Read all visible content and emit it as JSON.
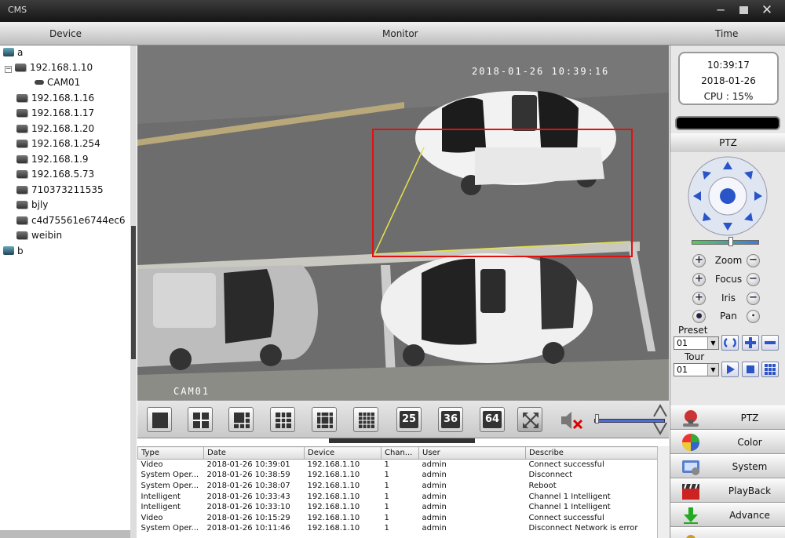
{
  "window": {
    "title": "CMS"
  },
  "header": {
    "device": "Device",
    "monitor": "Monitor",
    "time": "Time"
  },
  "tree": {
    "group_a": "a",
    "devices": [
      {
        "label": "192.168.1.10"
      },
      {
        "label": "CAM01"
      },
      {
        "label": "192.168.1.16"
      },
      {
        "label": "192.168.1.17"
      },
      {
        "label": "192.168.1.20"
      },
      {
        "label": "192.168.1.254"
      },
      {
        "label": "192.168.1.9"
      },
      {
        "label": "192.168.5.73"
      },
      {
        "label": "710373211535"
      },
      {
        "label": "bjly"
      },
      {
        "label": "c4d75561e6744ec6"
      },
      {
        "label": "weibin"
      }
    ],
    "group_b": "b"
  },
  "video": {
    "timestamp": "2018-01-26 10:39:16",
    "camera": "CAM01"
  },
  "layout_buttons": {
    "n25": "25",
    "n36": "36",
    "n64": "64"
  },
  "log": {
    "columns": {
      "type": "Type",
      "date": "Date",
      "device": "Device",
      "channel": "Chan...",
      "user": "User",
      "describe": "Describe"
    },
    "rows": [
      {
        "type": "Video",
        "date": "2018-01-26 10:39:01",
        "device": "192.168.1.10",
        "channel": "1",
        "user": "admin",
        "describe": "Connect successful"
      },
      {
        "type": "System Oper...",
        "date": "2018-01-26 10:38:59",
        "device": "192.168.1.10",
        "channel": "1",
        "user": "admin",
        "describe": "Disconnect"
      },
      {
        "type": "System Oper...",
        "date": "2018-01-26 10:38:07",
        "device": "192.168.1.10",
        "channel": "1",
        "user": "admin",
        "describe": "Reboot"
      },
      {
        "type": "Intelligent",
        "date": "2018-01-26 10:33:43",
        "device": "192.168.1.10",
        "channel": "1",
        "user": "admin",
        "describe": "Channel 1 Intelligent"
      },
      {
        "type": "Intelligent",
        "date": "2018-01-26 10:33:10",
        "device": "192.168.1.10",
        "channel": "1",
        "user": "admin",
        "describe": "Channel 1 Intelligent"
      },
      {
        "type": "Video",
        "date": "2018-01-26 10:15:29",
        "device": "192.168.1.10",
        "channel": "1",
        "user": "admin",
        "describe": "Connect successful"
      },
      {
        "type": "System Oper...",
        "date": "2018-01-26 10:11:46",
        "device": "192.168.1.10",
        "channel": "1",
        "user": "admin",
        "describe": "Disconnect Network is error"
      }
    ]
  },
  "clock": {
    "time": "10:39:17",
    "date": "2018-01-26",
    "cpu": "CPU : 15%"
  },
  "ptz": {
    "title": "PTZ",
    "zoom": "Zoom",
    "focus": "Focus",
    "iris": "Iris",
    "pan": "Pan",
    "preset_label": "Preset",
    "preset_value": "01",
    "tour_label": "Tour",
    "tour_value": "01"
  },
  "menu": {
    "ptz": "PTZ",
    "color": "Color",
    "system": "System",
    "playback": "PlayBack",
    "advance": "Advance"
  },
  "colors": {
    "accent": "#3355cc",
    "detection_box": "#e11111",
    "titlebar": "#1f1f1f"
  }
}
